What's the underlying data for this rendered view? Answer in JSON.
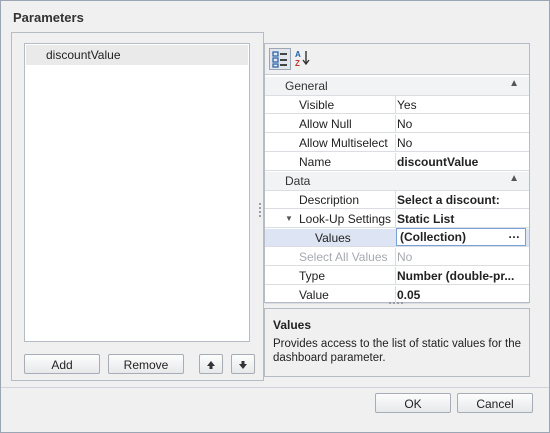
{
  "dialog": {
    "title": "Parameters",
    "ok_label": "OK",
    "cancel_label": "Cancel"
  },
  "parameters": {
    "items": [
      "discountValue"
    ],
    "add_label": "Add",
    "remove_label": "Remove"
  },
  "grid": {
    "general": {
      "label": "General",
      "rows": [
        {
          "name": "Visible",
          "value": "Yes"
        },
        {
          "name": "Allow Null",
          "value": "No"
        },
        {
          "name": "Allow Multiselect",
          "value": "No"
        },
        {
          "name": "Name",
          "value": "discountValue"
        }
      ]
    },
    "data": {
      "label": "Data",
      "rows": [
        {
          "name": "Description",
          "value": "Select a discount:"
        },
        {
          "name": "Look-Up Settings",
          "value": "Static List"
        },
        {
          "name": "Values",
          "value": "(Collection)"
        },
        {
          "name": "Select All Values",
          "value": "No"
        },
        {
          "name": "Type",
          "value": "Number (double-pr..."
        },
        {
          "name": "Value",
          "value": "0.05"
        }
      ]
    }
  },
  "description": {
    "title": "Values",
    "text": "Provides access to the list of static values for the dashboard parameter."
  }
}
